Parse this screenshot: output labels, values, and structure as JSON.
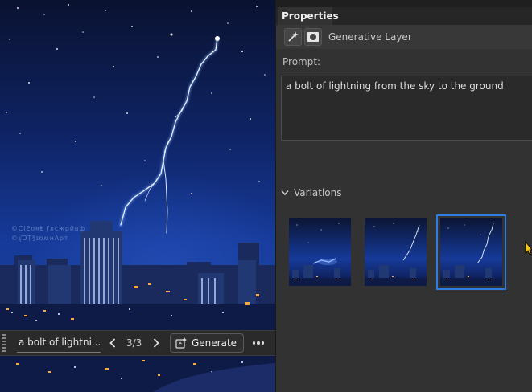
{
  "canvas": {
    "watermark_lines": [
      "©СІƧʊʀⱠ ƒлсжрйвф",
      "©ɻƊṬ§ɪʊʍнАрт"
    ]
  },
  "taskbar": {
    "prompt_text": "a bolt of lightni...",
    "counter": "3/3",
    "generate_label": "Generate",
    "icons": [
      "drag-grip-icon",
      "chevron-left-icon",
      "chevron-right-icon",
      "generate-sparkle-icon",
      "more-icon"
    ]
  },
  "panel": {
    "tab_label": "Properties",
    "layer": {
      "name": "Generative Layer",
      "icons": [
        "generative-fill-icon",
        "layer-mask-icon"
      ]
    },
    "prompt_label": "Prompt:",
    "prompt_value": "a bolt of lightning from the sky to the ground",
    "variations_label": "Variations",
    "variations": [
      {
        "name": "variation-1",
        "selected": false
      },
      {
        "name": "variation-2",
        "selected": false
      },
      {
        "name": "variation-3",
        "selected": true
      }
    ]
  },
  "colors": {
    "panel_bg": "#323232",
    "selection_accent": "#2f7de1",
    "cursor": "#f5c518"
  }
}
